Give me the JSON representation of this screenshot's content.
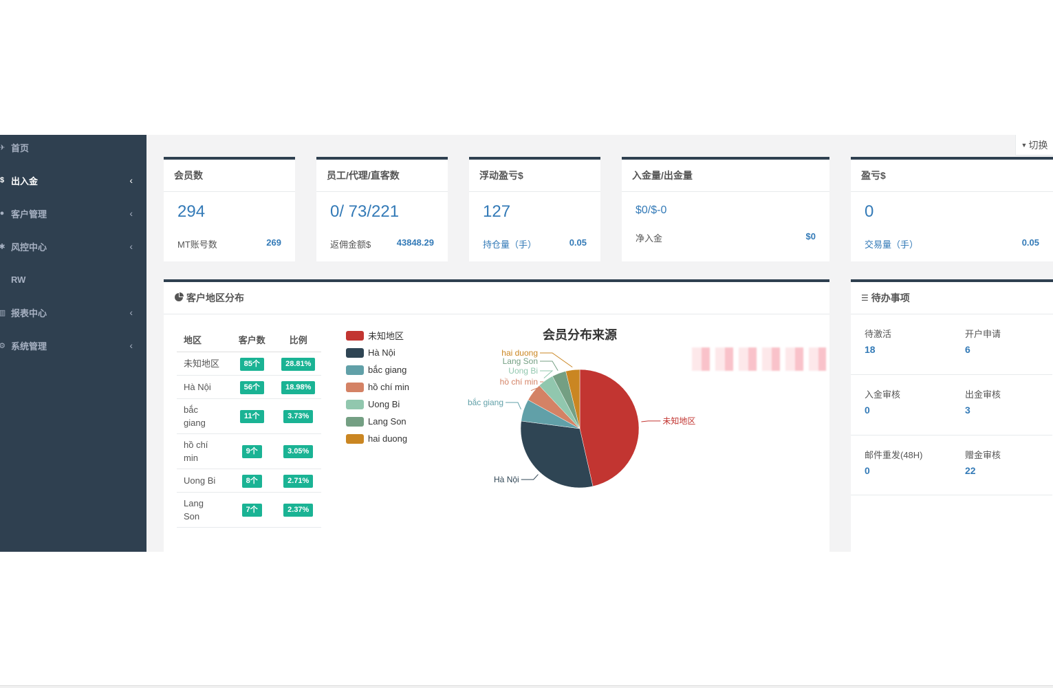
{
  "sidebar": {
    "items": [
      {
        "label": "首页",
        "icon": "home-icon",
        "active": false,
        "has_arrow": false
      },
      {
        "label": "出入金",
        "icon": "dollar-icon",
        "active": true,
        "has_arrow": true
      },
      {
        "label": "客户管理",
        "icon": "user-icon",
        "active": false,
        "has_arrow": true
      },
      {
        "label": "风控中心",
        "icon": "gear-icon",
        "active": false,
        "has_arrow": true
      },
      {
        "label": "RW",
        "icon": "",
        "active": false,
        "has_arrow": false
      },
      {
        "label": "报表中心",
        "icon": "bar-chart-icon",
        "active": false,
        "has_arrow": true
      },
      {
        "label": "系统管理",
        "icon": "network-icon",
        "active": false,
        "has_arrow": true
      }
    ]
  },
  "header": {
    "switch_label": "切换"
  },
  "stats": [
    {
      "title": "会员数",
      "main_value": "294",
      "sub_label": "MT账号数",
      "sub_value": "269"
    },
    {
      "title": "员工/代理/直客数",
      "main_value": "0/ 73/221",
      "sub_label": "返佣金额$",
      "sub_value": "43848.29"
    },
    {
      "title": "浮动盈亏$",
      "main_value": "127",
      "sub_label": "持仓量（手）",
      "sub_value": "0.05"
    },
    {
      "title": "入金量/出金量",
      "main_value": "$0/$-0",
      "sub_label": "净入金",
      "sub_value": "$0"
    },
    {
      "title": "盈亏$",
      "main_value": "0",
      "sub_label": "交易量（手）",
      "sub_value": "0.05"
    }
  ],
  "region_panel": {
    "title": "客户地区分布",
    "columns": [
      "地区",
      "客户数",
      "比例"
    ],
    "rows": [
      {
        "region": "未知地区",
        "count": "85个",
        "ratio": "28.81%"
      },
      {
        "region": "Hà Nội",
        "count": "56个",
        "ratio": "18.98%"
      },
      {
        "region": "bắc giang",
        "count": "11个",
        "ratio": "3.73%"
      },
      {
        "region": "hồ chí min",
        "count": "9个",
        "ratio": "3.05%"
      },
      {
        "region": "Uong Bi",
        "count": "8个",
        "ratio": "2.71%"
      },
      {
        "region": "Lang Son",
        "count": "7个",
        "ratio": "2.37%"
      }
    ]
  },
  "chart_data": {
    "type": "pie",
    "title": "会员分布来源",
    "categories": [
      "未知地区",
      "Hà Nội",
      "bắc giang",
      "hồ chí min",
      "Uong Bi",
      "Lang Son",
      "hai duong"
    ],
    "values": [
      85,
      56,
      11,
      9,
      8,
      7,
      7
    ],
    "colors": [
      "#c23531",
      "#2f4554",
      "#61a0a8",
      "#d48265",
      "#91c7ae",
      "#749f83",
      "#ca8622"
    ],
    "legend_position": "left"
  },
  "todo_panel": {
    "title": "待办事项",
    "items": [
      {
        "label": "待激活",
        "value": "18"
      },
      {
        "label": "开户申请",
        "value": "6"
      },
      {
        "label": "入金审核",
        "value": "0"
      },
      {
        "label": "出金审核",
        "value": "3"
      },
      {
        "label": "邮件重发(48H)",
        "value": "0"
      },
      {
        "label": "赠金审核",
        "value": "22"
      }
    ]
  }
}
